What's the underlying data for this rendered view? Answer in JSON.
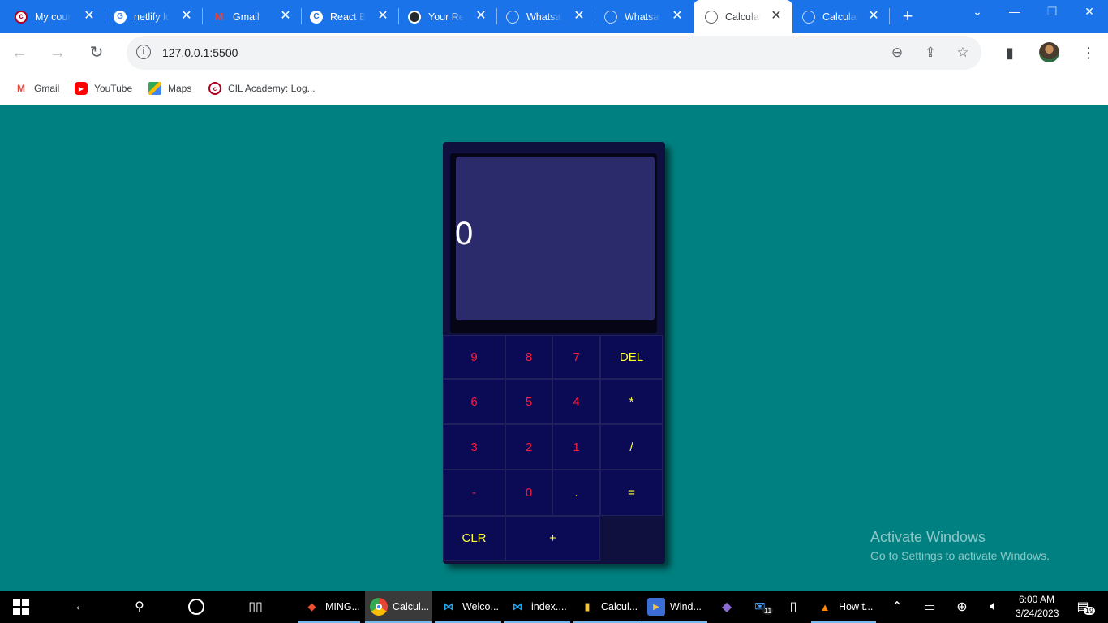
{
  "browser": {
    "tabs": [
      {
        "label": "My cour",
        "icon": "cil-academy-icon",
        "active": false
      },
      {
        "label": "netlify lo",
        "icon": "google-icon",
        "active": false
      },
      {
        "label": "Gmail",
        "icon": "gmail-icon",
        "active": false
      },
      {
        "label": "React Ba",
        "icon": "react-icon",
        "active": false
      },
      {
        "label": "Your Rep",
        "icon": "github-icon",
        "active": false
      },
      {
        "label": "Whatsap",
        "icon": "globe-icon",
        "active": false
      },
      {
        "label": "Whatsap",
        "icon": "globe-icon",
        "active": false
      },
      {
        "label": "Calculat",
        "icon": "globe-icon",
        "active": true
      },
      {
        "label": "Calculat",
        "icon": "globe-icon",
        "active": false
      }
    ],
    "url": "127.0.0.1:5500",
    "bookmarks": [
      {
        "label": "Gmail",
        "icon": "gmail-icon"
      },
      {
        "label": "YouTube",
        "icon": "youtube-icon"
      },
      {
        "label": "Maps",
        "icon": "maps-icon"
      },
      {
        "label": "CIL Academy: Log...",
        "icon": "cil-academy-icon"
      }
    ]
  },
  "calculator": {
    "display": "0",
    "keys": [
      {
        "label": "9",
        "kind": "num"
      },
      {
        "label": "8",
        "kind": "num"
      },
      {
        "label": "7",
        "kind": "num"
      },
      {
        "label": "DEL",
        "kind": "op"
      },
      {
        "label": "6",
        "kind": "num"
      },
      {
        "label": "5",
        "kind": "num"
      },
      {
        "label": "4",
        "kind": "num"
      },
      {
        "label": "*",
        "kind": "op"
      },
      {
        "label": "3",
        "kind": "num"
      },
      {
        "label": "2",
        "kind": "num"
      },
      {
        "label": "1",
        "kind": "num"
      },
      {
        "label": "/",
        "kind": "op"
      },
      {
        "label": "-",
        "kind": "num"
      },
      {
        "label": "0",
        "kind": "num"
      },
      {
        "label": ".",
        "kind": "op"
      },
      {
        "label": "=",
        "kind": "op"
      },
      {
        "label": "CLR",
        "kind": "op"
      },
      {
        "label": "+",
        "kind": "op"
      }
    ],
    "colors": {
      "body": "#10103e",
      "display": "#2b2a6b",
      "key": "#0b0b55",
      "number": "#ff1a3d",
      "operator": "#ffff33"
    }
  },
  "watermark": {
    "title": "Activate Windows",
    "subtitle": "Go to Settings to activate Windows."
  },
  "taskbar": {
    "apps": [
      {
        "label": "MING...",
        "icon": "git-icon"
      },
      {
        "label": "Calcul...",
        "icon": "chrome-icon"
      },
      {
        "label": "Welco...",
        "icon": "vscode-icon"
      },
      {
        "label": "index....",
        "icon": "vscode-icon"
      },
      {
        "label": "Calcul...",
        "icon": "folder-icon"
      },
      {
        "label": "Wind...",
        "icon": "media-icon"
      },
      {
        "label": "How t...",
        "icon": "vlc-icon"
      }
    ],
    "mail_badge": "11",
    "notification_badge": "19",
    "time": "6:00 AM",
    "date": "3/24/2023"
  }
}
